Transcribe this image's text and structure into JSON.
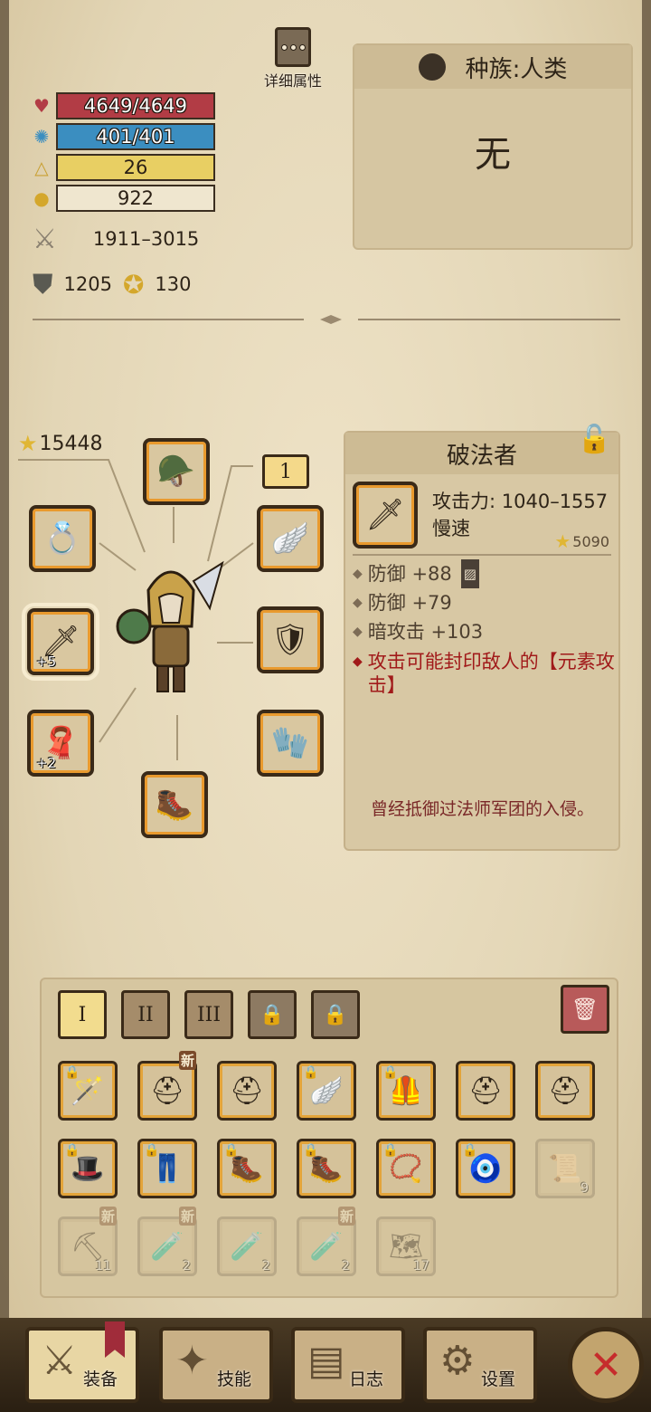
{
  "header": {
    "detail_label": "详细属性"
  },
  "stats": {
    "hp": "4649/4649",
    "mp": "401/401",
    "level": "26",
    "gold": "922",
    "attack": "1911–3015",
    "defense": "1205",
    "magic": "130"
  },
  "race": {
    "label": "种族:人类",
    "value": "无"
  },
  "equipment": {
    "power": "15448",
    "tier": "1",
    "slots": [
      {
        "name": "helmet-slot",
        "icon": "🪖",
        "plus": ""
      },
      {
        "name": "ring-slot",
        "icon": "💍",
        "plus": ""
      },
      {
        "name": "weapon-slot",
        "icon": "🗡",
        "plus": "+5"
      },
      {
        "name": "cape-slot",
        "icon": "🧣",
        "plus": "+2"
      },
      {
        "name": "boots-slot",
        "icon": "🥾",
        "plus": ""
      },
      {
        "name": "amulet-slot",
        "icon": "🪽",
        "plus": ""
      },
      {
        "name": "armor-slot",
        "icon": "🛡",
        "plus": ""
      },
      {
        "name": "gloves-slot",
        "icon": "🧤",
        "plus": ""
      }
    ]
  },
  "item": {
    "name": "破法者",
    "attack": "攻击力: 1040–1557",
    "speed": "慢速",
    "score": "5090",
    "props": [
      "防御 +88",
      "防御 +79",
      "暗攻击 +103"
    ],
    "special": "攻击可能封印敌人的【元素攻击】",
    "lore": "曾经抵御过法师军团的入侵。"
  },
  "inventory": {
    "tabs": [
      "I",
      "II",
      "III"
    ],
    "rows": [
      [
        {
          "icon": "🪄",
          "lock": true,
          "new": false,
          "count": "",
          "faded": false
        },
        {
          "icon": "⛑",
          "lock": false,
          "new": true,
          "count": "",
          "faded": false
        },
        {
          "icon": "⛑",
          "lock": false,
          "new": false,
          "count": "",
          "faded": false
        },
        {
          "icon": "🪽",
          "lock": true,
          "new": false,
          "count": "",
          "faded": false
        },
        {
          "icon": "🦺",
          "lock": true,
          "new": false,
          "count": "",
          "faded": false
        },
        {
          "icon": "⛑",
          "lock": false,
          "new": false,
          "count": "",
          "faded": false
        },
        {
          "icon": "⛑",
          "lock": false,
          "new": false,
          "count": "",
          "faded": false
        }
      ],
      [
        {
          "icon": "🎩",
          "lock": true,
          "new": false,
          "count": "",
          "faded": false
        },
        {
          "icon": "👖",
          "lock": true,
          "new": false,
          "count": "",
          "faded": false
        },
        {
          "icon": "🥾",
          "lock": true,
          "new": false,
          "count": "",
          "faded": false
        },
        {
          "icon": "🥾",
          "lock": true,
          "new": false,
          "count": "",
          "faded": false
        },
        {
          "icon": "📿",
          "lock": true,
          "new": false,
          "count": "",
          "faded": false
        },
        {
          "icon": "🧿",
          "lock": true,
          "new": false,
          "count": "",
          "faded": false
        },
        {
          "icon": "📜",
          "lock": false,
          "new": false,
          "count": "9",
          "faded": true
        }
      ],
      [
        {
          "icon": "⛏",
          "lock": false,
          "new": true,
          "count": "11",
          "faded": true
        },
        {
          "icon": "🧪",
          "lock": false,
          "new": true,
          "count": "2",
          "faded": true
        },
        {
          "icon": "🧪",
          "lock": false,
          "new": false,
          "count": "2",
          "faded": true
        },
        {
          "icon": "🧪",
          "lock": false,
          "new": true,
          "count": "2",
          "faded": true
        },
        {
          "icon": "🗺",
          "lock": false,
          "new": false,
          "count": "17",
          "faded": true
        }
      ]
    ]
  },
  "nav": {
    "items": [
      {
        "label": "装备",
        "icon": "⚔"
      },
      {
        "label": "技能",
        "icon": "✦"
      },
      {
        "label": "日志",
        "icon": "▤"
      },
      {
        "label": "设置",
        "icon": "⚙"
      }
    ],
    "close": "✕"
  },
  "colors": {
    "hp": "#b23c45",
    "mp": "#3b8ec0",
    "level": "#e8cf63",
    "accent": "#e99a2e",
    "special": "#a11a1a"
  }
}
